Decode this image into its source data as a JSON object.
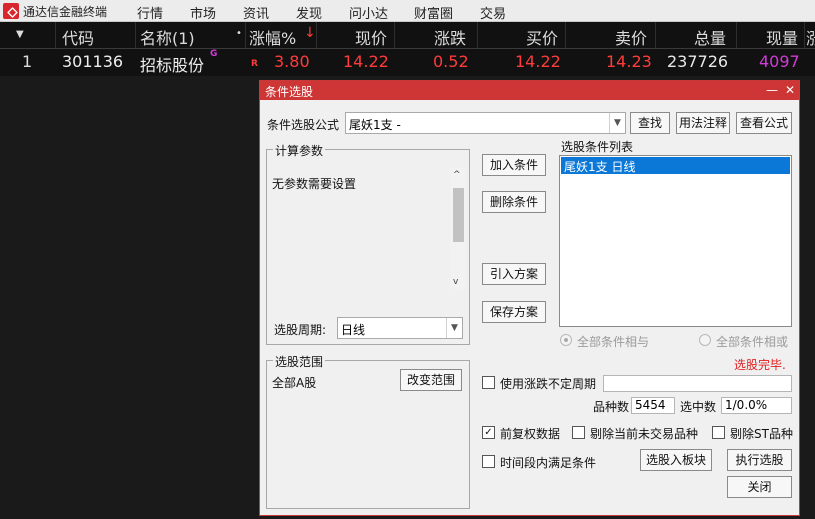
{
  "menu": {
    "app_title": "通达信金融终端",
    "items": [
      "行情",
      "市场",
      "资讯",
      "发现",
      "问小达",
      "财富圈",
      "交易"
    ]
  },
  "quote_table": {
    "headers": {
      "sort": "▼",
      "code": "代码",
      "name": "名称(1)",
      "dot": "•",
      "change_pct": "涨幅%",
      "arrow": "↓",
      "price": "现价",
      "change": "涨跌",
      "bid": "买价",
      "ask": "卖价",
      "volume": "总量",
      "now_vol": "现量",
      "more": "涨"
    },
    "row": {
      "index": "1",
      "code": "301136",
      "name": "招标股份",
      "name_tag": "G",
      "flag": "R",
      "change_pct": "3.80",
      "price": "14.22",
      "change": "0.52",
      "bid": "14.22",
      "ask": "14.23",
      "volume": "237726",
      "now_vol": "4097"
    }
  },
  "dialog": {
    "title": "条件选股",
    "min": "—",
    "close": "✕",
    "formula_label": "条件选股公式",
    "formula_value": "尾妖1支  -",
    "find_button": "查找",
    "usage_button": "用法注释",
    "view_button": "查看公式",
    "params_group": "计算参数",
    "params_text": "无参数需要设置",
    "period_label": "选股周期:",
    "period_value": "日线",
    "add_button": "加入条件",
    "delete_button": "删除条件",
    "import_button": "引入方案",
    "save_button": "保存方案",
    "cond_list_label": "选股条件列表",
    "cond_items": [
      "尾妖1支  日线"
    ],
    "radio_and": "全部条件相与",
    "radio_or": "全部条件相或",
    "status": "选股完毕.",
    "range_group": "选股范围",
    "range_value": "全部A股",
    "change_range_button": "改变范围",
    "use_period": "使用涨跌不定周期",
    "count_label": "品种数",
    "count_value": "5454",
    "selected_label": "选中数",
    "selected_value": "1/0.0%",
    "check_qfq": "前复权数据",
    "check_qfq_mark": "✓",
    "check_notrade": "剔除当前未交易品种",
    "check_st": "剔除ST品种",
    "check_interval": "时间段内满足条件",
    "to_block_button": "选股入板块",
    "run_button": "执行选股",
    "close_button": "关闭"
  }
}
